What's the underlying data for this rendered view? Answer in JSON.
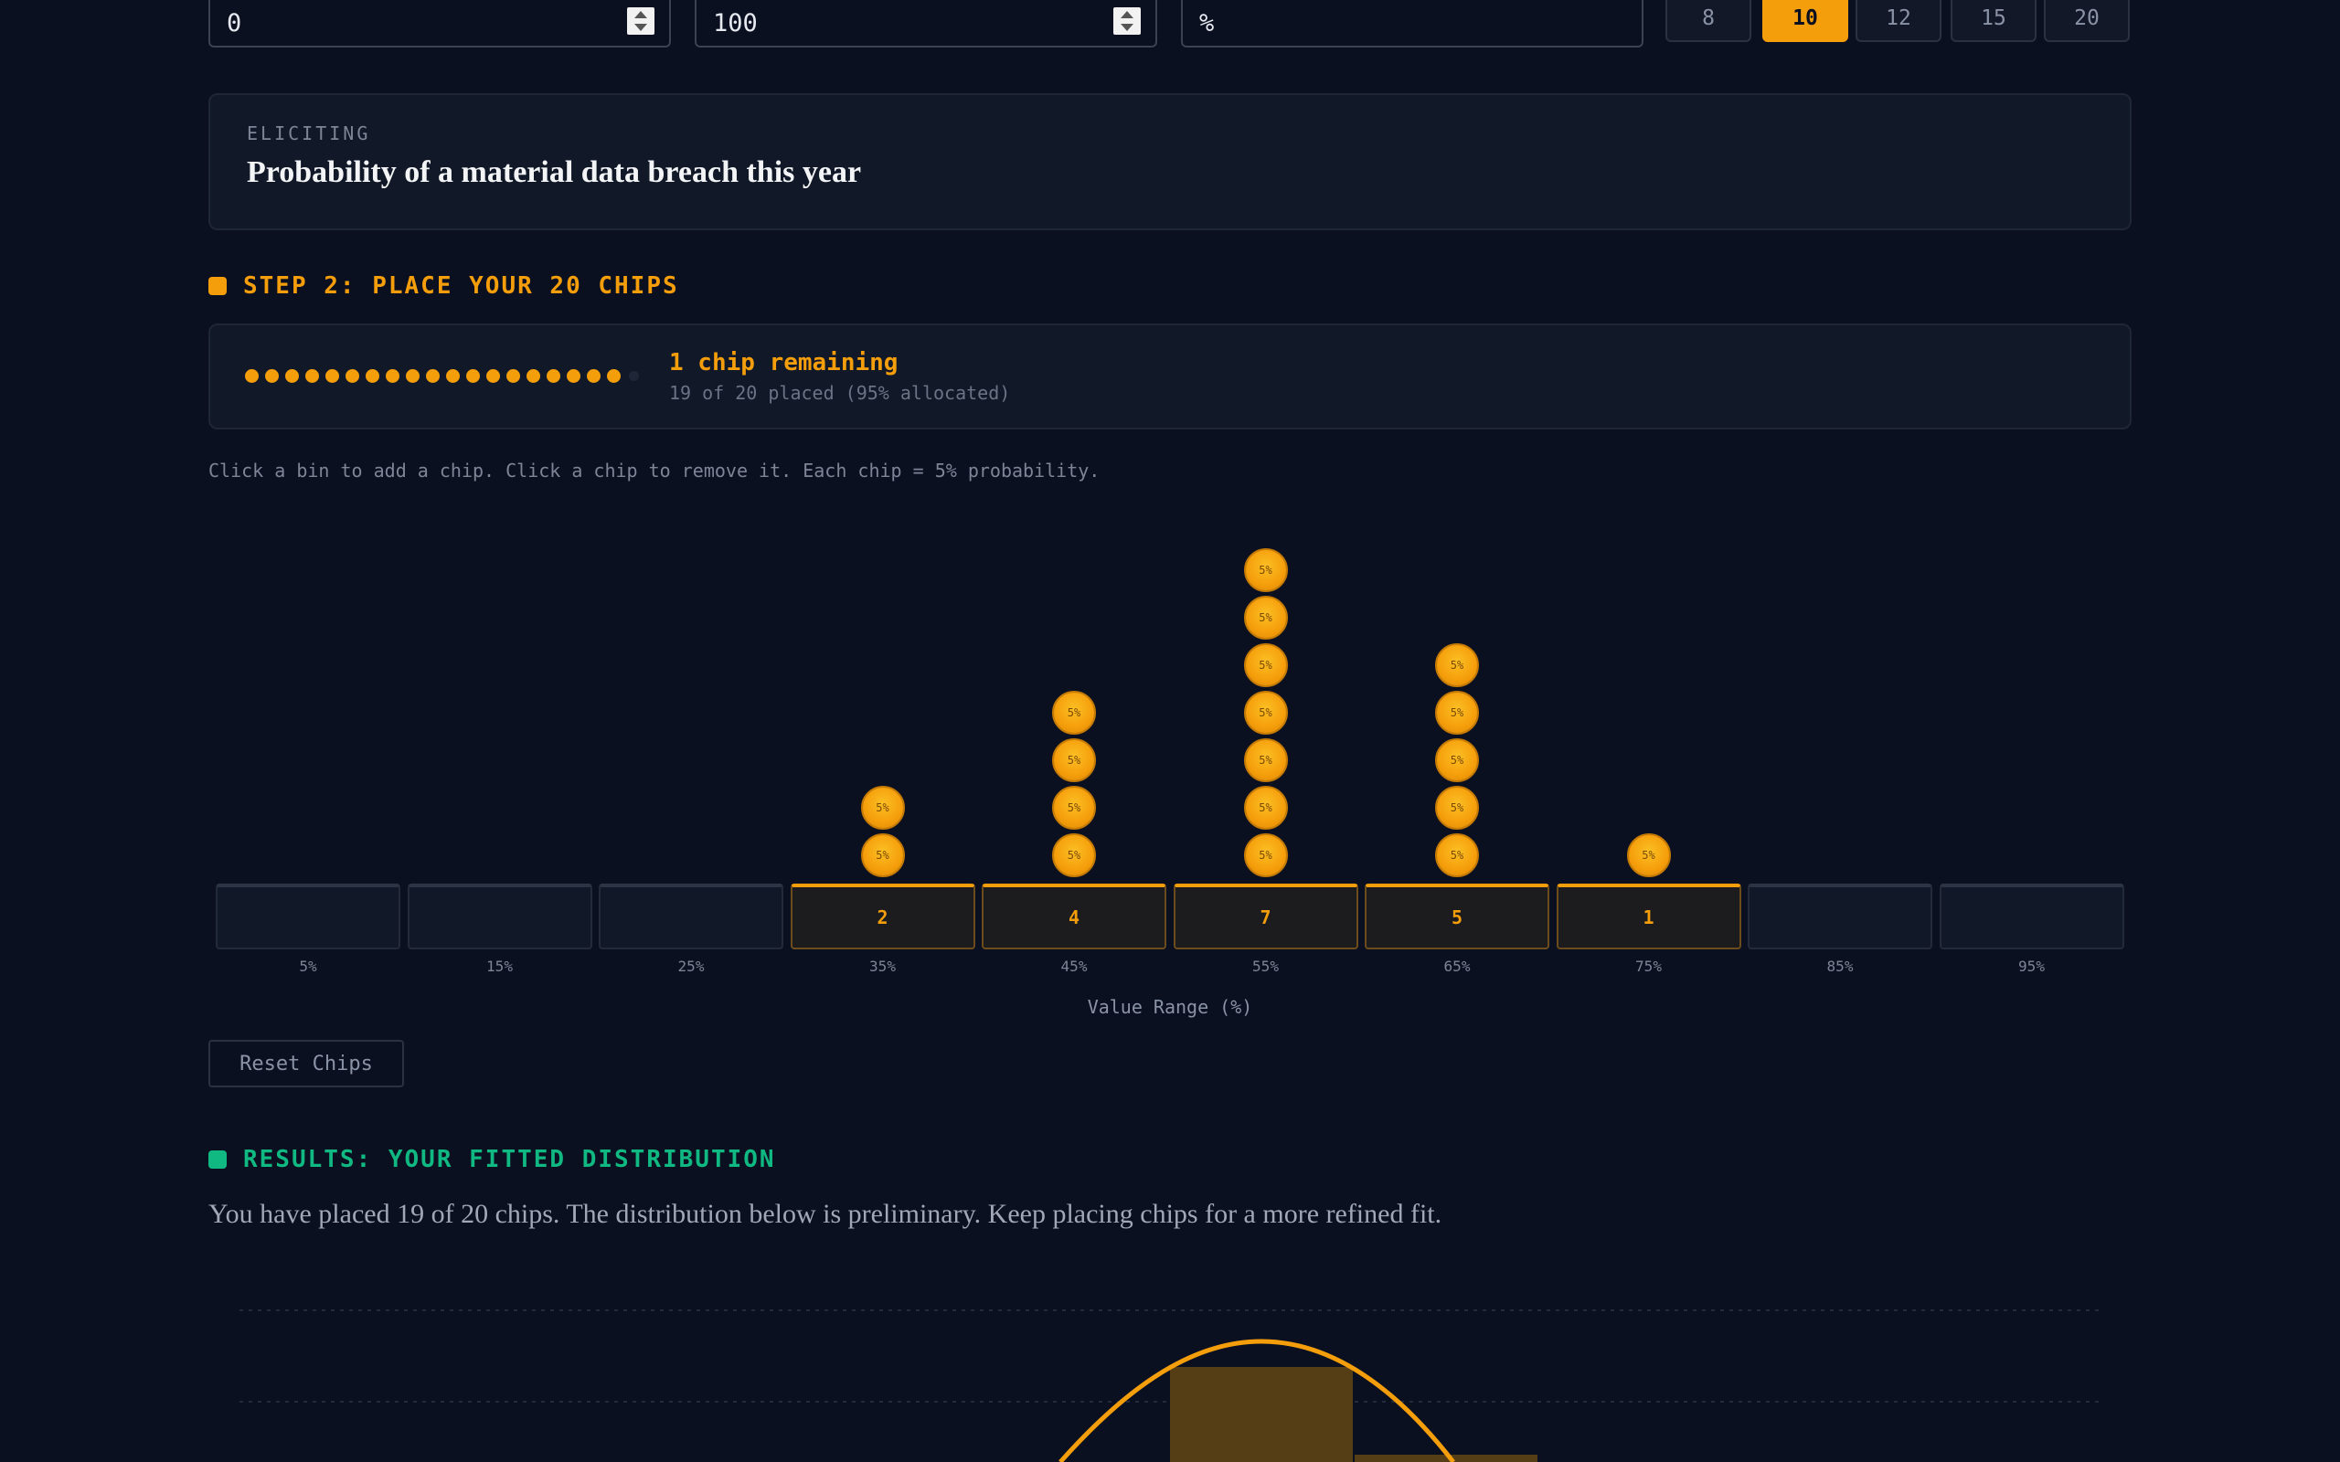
{
  "inputs": {
    "min_value": "0",
    "max_value": "100",
    "unit": "%"
  },
  "bin_count_options": [
    {
      "label": "8",
      "active": false
    },
    {
      "label": "10",
      "active": true
    },
    {
      "label": "12",
      "active": false
    },
    {
      "label": "15",
      "active": false
    },
    {
      "label": "20",
      "active": false
    }
  ],
  "eliciting": {
    "label": "ELICITING",
    "title": "Probability of a material data breach this year"
  },
  "step2": {
    "heading": "STEP 2: PLACE YOUR 20 CHIPS",
    "remaining": "1 chip remaining",
    "placed": "19 of 20 placed (95% allocated)",
    "hint": "Click a bin to add a chip. Click a chip to remove it. Each chip = 5% probability.",
    "total_chips": 20,
    "placed_count": 19,
    "chip_label": "5%",
    "reset_label": "Reset Chips",
    "axis_title": "Value Range (%)"
  },
  "bins": [
    {
      "label": "5%",
      "count": 0,
      "count_text": ""
    },
    {
      "label": "15%",
      "count": 0,
      "count_text": ""
    },
    {
      "label": "25%",
      "count": 0,
      "count_text": ""
    },
    {
      "label": "35%",
      "count": 2,
      "count_text": "2"
    },
    {
      "label": "45%",
      "count": 4,
      "count_text": "4"
    },
    {
      "label": "55%",
      "count": 7,
      "count_text": "7"
    },
    {
      "label": "65%",
      "count": 5,
      "count_text": "5"
    },
    {
      "label": "75%",
      "count": 1,
      "count_text": "1"
    },
    {
      "label": "85%",
      "count": 0,
      "count_text": ""
    },
    {
      "label": "95%",
      "count": 0,
      "count_text": ""
    }
  ],
  "results": {
    "heading": "RESULTS: YOUR FITTED DISTRIBUTION",
    "message": "You have placed 19 of 20 chips. The distribution below is preliminary. Keep placing chips for a more refined fit."
  },
  "colors": {
    "accent": "#f59e0b",
    "results_accent": "#10b981",
    "background": "#0b1020"
  }
}
